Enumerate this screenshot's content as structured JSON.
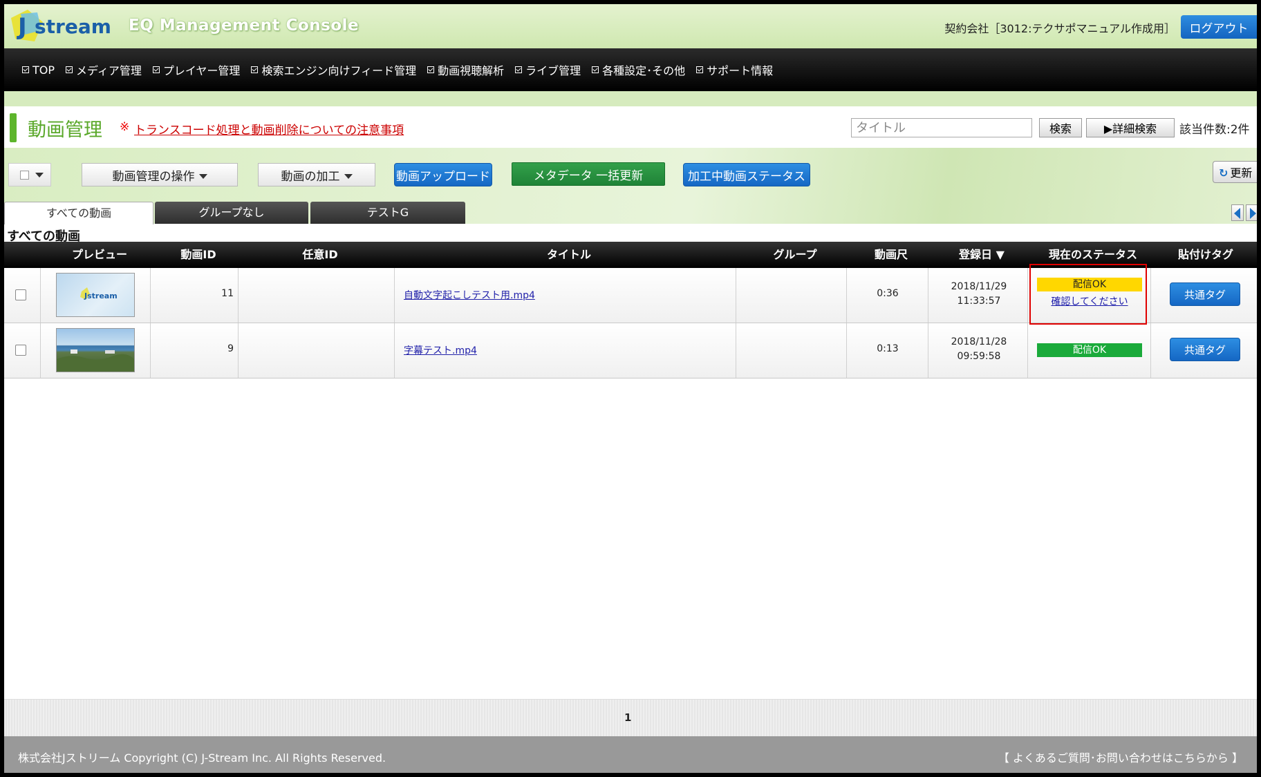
{
  "header": {
    "logo_text": "Jstream",
    "console_title": "EQ Management Console",
    "company": "契約会社［3012:テクサポマニュアル作成用］",
    "logout_label": "ログアウト"
  },
  "nav": {
    "items": [
      {
        "label": "TOP"
      },
      {
        "label": "メディア管理"
      },
      {
        "label": "プレイヤー管理"
      },
      {
        "label": "検索エンジン向けフィード管理"
      },
      {
        "label": "動画視聴解析"
      },
      {
        "label": "ライブ管理"
      },
      {
        "label": "各種設定･その他"
      },
      {
        "label": "サポート情報"
      }
    ]
  },
  "page": {
    "title": "動画管理",
    "notice_mark": "※",
    "notice_link": "トランスコード処理と動画削除についての注意事項"
  },
  "search": {
    "placeholder": "タイトル",
    "search_label": "検索",
    "advanced_label": "詳細検索",
    "advanced_prefix": "▶",
    "result_count": "該当件数:2件"
  },
  "toolbar": {
    "manage_ops_label": "動画管理の操作",
    "processing_label": "動画の加工",
    "upload_label": "動画アップロード",
    "bulk_meta_label": "メタデータ 一括更新",
    "processing_status_label": "加工中動画ステータス",
    "refresh_label": "更新"
  },
  "tabs": [
    {
      "label": "すべての動画",
      "active": true
    },
    {
      "label": "グループなし",
      "active": false
    },
    {
      "label": "テストG",
      "active": false
    }
  ],
  "list_heading": "すべての動画",
  "table": {
    "columns": [
      "プレビュー",
      "動画ID",
      "任意ID",
      "タイトル",
      "グループ",
      "動画尺",
      "登録日 ▼",
      "現在のステータス",
      "貼付けタグ"
    ],
    "rows": [
      {
        "id": "11",
        "custom_id": "",
        "title": "自動文字起こしテスト用.mp4",
        "group": "",
        "duration": "0:36",
        "reg_date": "2018/11/29",
        "reg_time": "11:33:57",
        "status": "配信OK",
        "status_color": "#ffd700",
        "status_note": "確認してください",
        "tag_label": "共通タグ",
        "thumb_text": "Jstream"
      },
      {
        "id": "9",
        "custom_id": "",
        "title": "字幕テスト.mp4",
        "group": "",
        "duration": "0:13",
        "reg_date": "2018/11/28",
        "reg_time": "09:59:58",
        "status": "配信OK",
        "status_color": "#1aaa3a",
        "status_note": "",
        "tag_label": "共通タグ"
      }
    ]
  },
  "pagination": {
    "current": "1"
  },
  "footer": {
    "copyright": "株式会社Jストリーム Copyright (C) J-Stream Inc. All Rights Reserved.",
    "faq": "【 よくあるご質問･お問い合わせはこちらから 】"
  },
  "colors": {
    "accent_green": "#5aa82a",
    "button_blue": "#1a6fc4",
    "button_green": "#1f8337",
    "notice_red": "#c00000"
  }
}
